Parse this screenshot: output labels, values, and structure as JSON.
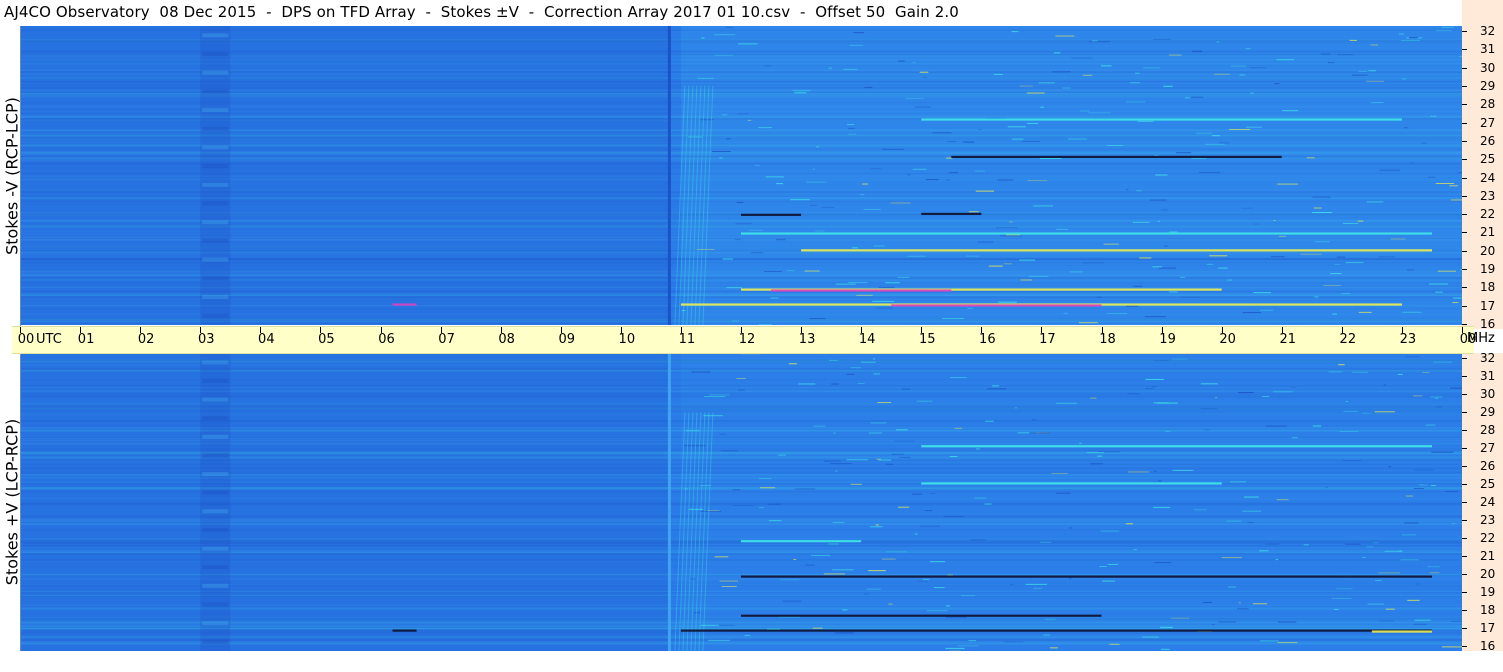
{
  "title": "AJ4CO Observatory  08 Dec 2015  -  DPS on TFD Array  -  Stokes ±V  -  Correction Array 2017 01 10.csv  -  Offset 50  Gain 2.0",
  "colors": {
    "background_blue": "#2a7ae8",
    "dark_blue": "#1a4fc4",
    "light_blue": "#45b0f0",
    "cyan": "#40e8e8",
    "yellow": "#f0f050",
    "magenta": "#e040c0",
    "black_streak": "#101030",
    "time_axis_bg": "#ffffc8",
    "freq_axis_bg": "#ffead9"
  },
  "chart_data": [
    {
      "type": "heatmap",
      "name": "top",
      "ylabel": "Stokes -V (RCP-LCP)",
      "xlabel": "UTC",
      "ylim": [
        16,
        32
      ],
      "yunit": "MHz",
      "xlim": [
        0,
        24
      ],
      "x_ticks": [
        "00",
        "01",
        "02",
        "03",
        "04",
        "05",
        "06",
        "07",
        "08",
        "09",
        "10",
        "11",
        "12",
        "13",
        "14",
        "15",
        "16",
        "17",
        "18",
        "19",
        "20",
        "21",
        "22",
        "23",
        "00"
      ],
      "y_ticks": [
        16,
        17,
        18,
        19,
        20,
        21,
        22,
        23,
        24,
        25,
        26,
        27,
        28,
        29,
        30,
        31,
        32
      ],
      "features": [
        {
          "kind": "hband",
          "x": [
            3.0,
            3.5
          ],
          "y": [
            16,
            32
          ],
          "color": "dark_blue",
          "opacity": 0.25
        },
        {
          "kind": "vline",
          "x": 10.8,
          "y": [
            16,
            32
          ],
          "color": "dark_blue",
          "opacity": 0.9
        },
        {
          "kind": "streak",
          "x": [
            12.0,
            20.0
          ],
          "y": 17.9,
          "color": "yellow"
        },
        {
          "kind": "streak",
          "x": [
            12.5,
            15.5
          ],
          "y": 17.85,
          "color": "magenta"
        },
        {
          "kind": "streak",
          "x": [
            11.0,
            23.0
          ],
          "y": 17.1,
          "color": "yellow"
        },
        {
          "kind": "streak",
          "x": [
            14.5,
            18.0
          ],
          "y": 17.05,
          "color": "magenta"
        },
        {
          "kind": "streak",
          "x": [
            12.0,
            13.0
          ],
          "y": 21.9,
          "color": "black_streak"
        },
        {
          "kind": "streak",
          "x": [
            15.0,
            16.0
          ],
          "y": 21.95,
          "color": "black_streak"
        },
        {
          "kind": "streak",
          "x": [
            15.5,
            21.0
          ],
          "y": 25.0,
          "color": "black_streak"
        },
        {
          "kind": "streak",
          "x": [
            12.0,
            23.5
          ],
          "y": 20.9,
          "color": "cyan"
        },
        {
          "kind": "streak",
          "x": [
            13.0,
            23.5
          ],
          "y": 20.0,
          "color": "yellow"
        },
        {
          "kind": "streak",
          "x": [
            15.0,
            23.0
          ],
          "y": 27.0,
          "color": "cyan"
        },
        {
          "kind": "streak",
          "x": [
            6.2,
            6.6
          ],
          "y": 17.1,
          "color": "magenta"
        }
      ]
    },
    {
      "type": "heatmap",
      "name": "bottom",
      "ylabel": "Stokes +V (LCP-RCP)",
      "xlabel": "UTC",
      "ylim": [
        16,
        32
      ],
      "yunit": "MHz",
      "xlim": [
        0,
        24
      ],
      "x_ticks": [
        "00",
        "01",
        "02",
        "03",
        "04",
        "05",
        "06",
        "07",
        "08",
        "09",
        "10",
        "11",
        "12",
        "13",
        "14",
        "15",
        "16",
        "17",
        "18",
        "19",
        "20",
        "21",
        "22",
        "23",
        "00"
      ],
      "y_ticks": [
        16,
        17,
        18,
        19,
        20,
        21,
        22,
        23,
        24,
        25,
        26,
        27,
        28,
        29,
        30,
        31,
        32
      ],
      "features": [
        {
          "kind": "hband",
          "x": [
            3.0,
            3.5
          ],
          "y": [
            16,
            32
          ],
          "color": "dark_blue",
          "opacity": 0.25
        },
        {
          "kind": "vline",
          "x": 10.8,
          "y": [
            16,
            32
          ],
          "color": "light_blue",
          "opacity": 0.8
        },
        {
          "kind": "streak",
          "x": [
            12.0,
            18.0
          ],
          "y": 17.9,
          "color": "black_streak"
        },
        {
          "kind": "streak",
          "x": [
            11.0,
            23.5
          ],
          "y": 17.1,
          "color": "black_streak"
        },
        {
          "kind": "streak",
          "x": [
            22.5,
            23.5
          ],
          "y": 17.05,
          "color": "yellow"
        },
        {
          "kind": "streak",
          "x": [
            12.0,
            14.0
          ],
          "y": 21.9,
          "color": "cyan"
        },
        {
          "kind": "streak",
          "x": [
            12.0,
            23.5
          ],
          "y": 20.0,
          "color": "black_streak"
        },
        {
          "kind": "streak",
          "x": [
            15.0,
            23.5
          ],
          "y": 27.0,
          "color": "cyan"
        },
        {
          "kind": "streak",
          "x": [
            15.0,
            20.0
          ],
          "y": 25.0,
          "color": "cyan"
        },
        {
          "kind": "streak",
          "x": [
            6.2,
            6.6
          ],
          "y": 17.1,
          "color": "black_streak"
        }
      ]
    }
  ]
}
